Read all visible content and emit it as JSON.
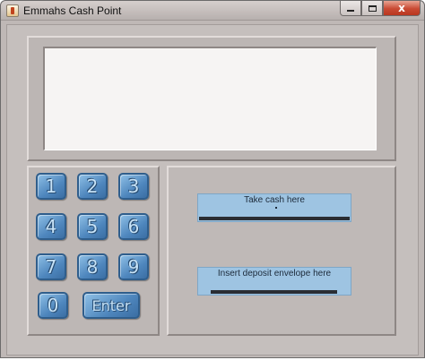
{
  "window": {
    "title": "Emmahs Cash Point",
    "close_label": "x"
  },
  "keypad": {
    "keys": [
      "1",
      "2",
      "3",
      "4",
      "5",
      "6",
      "7",
      "8",
      "9",
      "0"
    ],
    "enter_label": "Enter"
  },
  "slots": {
    "cash_label": "Take cash here",
    "deposit_label": "Insert deposit envelope here"
  },
  "colors": {
    "key_blue": "#4e86bd",
    "slot_blue": "#9ec4e2",
    "panel_grey": "#c5bfbd",
    "close_red": "#c94a33"
  }
}
